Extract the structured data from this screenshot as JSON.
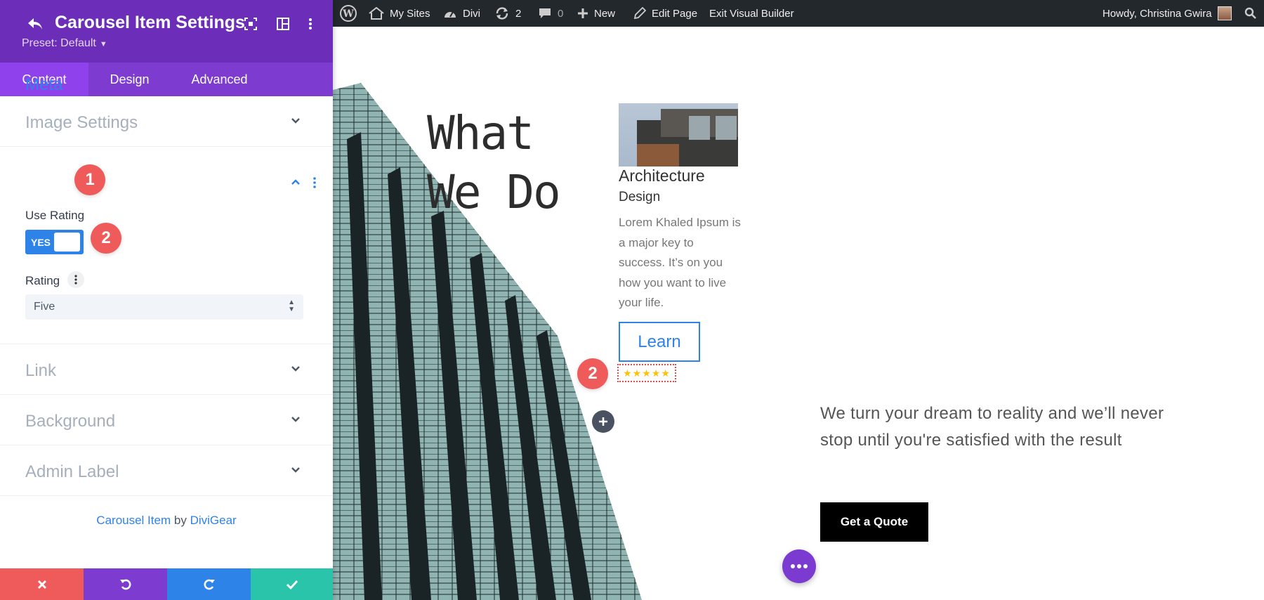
{
  "panel": {
    "title": "Carousel Item Settings",
    "preset": "Preset: Default",
    "tabs": [
      {
        "label": "Content",
        "active": true
      },
      {
        "label": "Design",
        "active": false
      },
      {
        "label": "Advanced",
        "active": false
      }
    ],
    "sections": {
      "image": "Image Settings",
      "meta": "Meta",
      "link": "Link",
      "background": "Background",
      "admin_label": "Admin Label"
    },
    "meta": {
      "use_rating_label": "Use Rating",
      "toggle_value": "YES",
      "rating_label": "Rating",
      "rating_value": "Five"
    },
    "badges": {
      "one": "1",
      "two": "2"
    },
    "credit": {
      "module": "Carousel Item",
      "by": "by",
      "author": "DiviGear"
    },
    "colors": {
      "header": "#6c2eb9",
      "tabs": "#7e3bd0",
      "accent": "#2e83e8",
      "badge": "#ef5b5b"
    }
  },
  "adminbar": {
    "my_sites": "My Sites",
    "divi": "Divi",
    "updates_count": "2",
    "comments_count": "0",
    "new": "New",
    "edit_page": "Edit Page",
    "exit_builder": "Exit Visual Builder",
    "howdy": "Howdy, Christina Gwira"
  },
  "page": {
    "heading_line1": "What",
    "heading_line2": "We Do",
    "card_title": "Architecture",
    "card_subtitle": "Design",
    "card_body": "Lorem Khaled Ipsum is a major key to success. It’s on you how you want to live your life.",
    "learn_button": "Learn",
    "rating_stars": "★★★★★",
    "tagline": "We turn your dream to reality and we’ll never stop until you're satisfied with the result",
    "quote_button": "Get a Quote",
    "badge": "2"
  }
}
